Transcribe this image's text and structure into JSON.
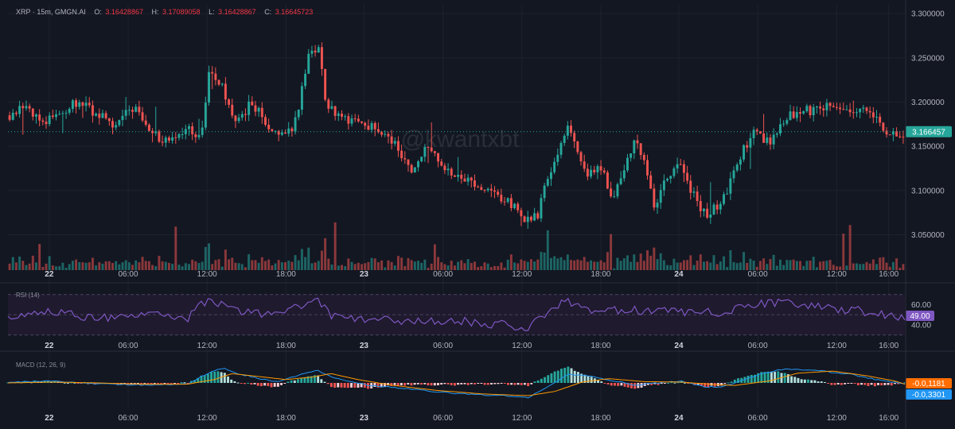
{
  "header": {
    "symbol": "XRP · 15m, GMGN.AI",
    "o_label": "O:",
    "o_value": "3.16428867",
    "h_label": "H:",
    "h_value": "3.17089058",
    "l_label": "L:",
    "l_value": "3.16428867",
    "c_label": "C:",
    "c_value": "3.16645723"
  },
  "watermark": "@kwantxbt",
  "colors": {
    "background": "#131722",
    "up": "#26a69a",
    "down": "#ef5350",
    "rsi_line": "#7e57c2",
    "rsi_band": "#1f1a2e",
    "macd_line": "#2196f3",
    "signal_line": "#ff9800",
    "price_tag": "#26a69a",
    "rsi_tag": "#7e57c2",
    "macd_tag_orange": "#ff6d00",
    "macd_tag_blue": "#2196f3"
  },
  "chart_data": {
    "type": "candlestick",
    "interval": "15m",
    "x_ticks": [
      {
        "label": "22",
        "bold": true,
        "pos": 0.046
      },
      {
        "label": "06:00",
        "bold": false,
        "pos": 0.134
      },
      {
        "label": "12:00",
        "bold": false,
        "pos": 0.222
      },
      {
        "label": "18:00",
        "bold": false,
        "pos": 0.31
      },
      {
        "label": "23",
        "bold": true,
        "pos": 0.397
      },
      {
        "label": "06:00",
        "bold": false,
        "pos": 0.485
      },
      {
        "label": "12:00",
        "bold": false,
        "pos": 0.573
      },
      {
        "label": "18:00",
        "bold": false,
        "pos": 0.661
      },
      {
        "label": "24",
        "bold": true,
        "pos": 0.748
      },
      {
        "label": "06:00",
        "bold": false,
        "pos": 0.836
      },
      {
        "label": "12:00",
        "bold": false,
        "pos": 0.924
      },
      {
        "label": "16:00",
        "bold": false,
        "pos": 0.982
      }
    ],
    "price": {
      "y_ticks": [
        "3.300000",
        "3.250000",
        "3.200000",
        "3.150000",
        "3.100000",
        "3.050000"
      ],
      "ylim": [
        3.01,
        3.31
      ],
      "last_price": "3.166457",
      "path": [
        [
          0,
          3.185
        ],
        [
          0.02,
          3.195
        ],
        [
          0.04,
          3.175
        ],
        [
          0.06,
          3.19
        ],
        [
          0.08,
          3.2
        ],
        [
          0.1,
          3.185
        ],
        [
          0.12,
          3.175
        ],
        [
          0.14,
          3.195
        ],
        [
          0.16,
          3.165
        ],
        [
          0.18,
          3.155
        ],
        [
          0.2,
          3.17
        ],
        [
          0.215,
          3.16
        ],
        [
          0.225,
          3.24
        ],
        [
          0.24,
          3.215
        ],
        [
          0.255,
          3.175
        ],
        [
          0.27,
          3.2
        ],
        [
          0.29,
          3.175
        ],
        [
          0.3,
          3.16
        ],
        [
          0.32,
          3.175
        ],
        [
          0.335,
          3.25
        ],
        [
          0.345,
          3.265
        ],
        [
          0.355,
          3.2
        ],
        [
          0.37,
          3.185
        ],
        [
          0.39,
          3.175
        ],
        [
          0.41,
          3.17
        ],
        [
          0.43,
          3.155
        ],
        [
          0.45,
          3.125
        ],
        [
          0.47,
          3.155
        ],
        [
          0.48,
          3.13
        ],
        [
          0.5,
          3.12
        ],
        [
          0.52,
          3.11
        ],
        [
          0.54,
          3.095
        ],
        [
          0.56,
          3.085
        ],
        [
          0.58,
          3.065
        ],
        [
          0.59,
          3.07
        ],
        [
          0.6,
          3.11
        ],
        [
          0.61,
          3.13
        ],
        [
          0.625,
          3.17
        ],
        [
          0.635,
          3.15
        ],
        [
          0.645,
          3.115
        ],
        [
          0.66,
          3.13
        ],
        [
          0.675,
          3.09
        ],
        [
          0.69,
          3.135
        ],
        [
          0.7,
          3.155
        ],
        [
          0.71,
          3.13
        ],
        [
          0.72,
          3.08
        ],
        [
          0.735,
          3.115
        ],
        [
          0.75,
          3.135
        ],
        [
          0.76,
          3.105
        ],
        [
          0.77,
          3.085
        ],
        [
          0.78,
          3.07
        ],
        [
          0.8,
          3.095
        ],
        [
          0.815,
          3.135
        ],
        [
          0.83,
          3.165
        ],
        [
          0.85,
          3.155
        ],
        [
          0.865,
          3.18
        ],
        [
          0.88,
          3.19
        ],
        [
          0.9,
          3.19
        ],
        [
          0.92,
          3.195
        ],
        [
          0.94,
          3.185
        ],
        [
          0.96,
          3.195
        ],
        [
          0.98,
          3.165
        ],
        [
          1.0,
          3.166
        ]
      ]
    },
    "rsi": {
      "label": "RSI (14)",
      "y_ticks": [
        "60.00",
        "40.00"
      ],
      "ylim": [
        25,
        80
      ],
      "band": [
        30,
        70
      ],
      "last_value": "49.00",
      "path": [
        [
          0,
          49
        ],
        [
          0.05,
          53
        ],
        [
          0.1,
          47
        ],
        [
          0.15,
          50
        ],
        [
          0.2,
          46
        ],
        [
          0.225,
          68
        ],
        [
          0.24,
          58
        ],
        [
          0.26,
          52
        ],
        [
          0.3,
          50
        ],
        [
          0.335,
          62
        ],
        [
          0.345,
          65
        ],
        [
          0.36,
          48
        ],
        [
          0.4,
          45
        ],
        [
          0.45,
          44
        ],
        [
          0.5,
          44
        ],
        [
          0.55,
          40
        ],
        [
          0.58,
          37
        ],
        [
          0.6,
          52
        ],
        [
          0.625,
          64
        ],
        [
          0.65,
          52
        ],
        [
          0.7,
          55
        ],
        [
          0.75,
          52
        ],
        [
          0.8,
          52
        ],
        [
          0.83,
          60
        ],
        [
          0.86,
          62
        ],
        [
          0.9,
          58
        ],
        [
          0.94,
          55
        ],
        [
          0.98,
          49
        ],
        [
          1.0,
          49
        ]
      ]
    },
    "macd": {
      "label": "MACD (12, 26, 9)",
      "params": [
        12,
        26,
        9
      ],
      "ylim": [
        -6,
        6
      ],
      "macd_value": "-0.0,1181",
      "signal_value": "-0.0,3301",
      "macd_path": [
        [
          0,
          0.2
        ],
        [
          0.05,
          0.5
        ],
        [
          0.1,
          -0.2
        ],
        [
          0.15,
          -0.5
        ],
        [
          0.2,
          -0.3
        ],
        [
          0.225,
          2.5
        ],
        [
          0.24,
          3.5
        ],
        [
          0.26,
          2.0
        ],
        [
          0.3,
          0.2
        ],
        [
          0.335,
          2.5
        ],
        [
          0.345,
          3.0
        ],
        [
          0.36,
          1.5
        ],
        [
          0.4,
          -0.5
        ],
        [
          0.45,
          -1.5
        ],
        [
          0.5,
          -2.5
        ],
        [
          0.55,
          -3.0
        ],
        [
          0.58,
          -3.5
        ],
        [
          0.6,
          -1.0
        ],
        [
          0.625,
          2.0
        ],
        [
          0.65,
          1.5
        ],
        [
          0.7,
          -0.5
        ],
        [
          0.75,
          0.5
        ],
        [
          0.78,
          -1.0
        ],
        [
          0.8,
          -0.8
        ],
        [
          0.83,
          1.5
        ],
        [
          0.86,
          3.2
        ],
        [
          0.9,
          3.0
        ],
        [
          0.94,
          2.0
        ],
        [
          0.98,
          0.3
        ],
        [
          1.0,
          -0.1
        ]
      ],
      "signal_path": [
        [
          0,
          0.0
        ],
        [
          0.05,
          0.2
        ],
        [
          0.1,
          0.0
        ],
        [
          0.15,
          -0.3
        ],
        [
          0.2,
          -0.3
        ],
        [
          0.23,
          0.8
        ],
        [
          0.25,
          2.2
        ],
        [
          0.28,
          1.5
        ],
        [
          0.31,
          0.8
        ],
        [
          0.34,
          1.4
        ],
        [
          0.36,
          2.2
        ],
        [
          0.39,
          0.8
        ],
        [
          0.43,
          -0.6
        ],
        [
          0.48,
          -1.8
        ],
        [
          0.53,
          -2.6
        ],
        [
          0.58,
          -3.0
        ],
        [
          0.61,
          -2.0
        ],
        [
          0.64,
          0.2
        ],
        [
          0.67,
          1.0
        ],
        [
          0.71,
          0.3
        ],
        [
          0.75,
          0.2
        ],
        [
          0.79,
          -0.4
        ],
        [
          0.81,
          -0.6
        ],
        [
          0.85,
          0.5
        ],
        [
          0.88,
          2.3
        ],
        [
          0.92,
          2.8
        ],
        [
          0.96,
          1.6
        ],
        [
          0.99,
          0.4
        ],
        [
          1.0,
          -0.3
        ]
      ]
    }
  }
}
